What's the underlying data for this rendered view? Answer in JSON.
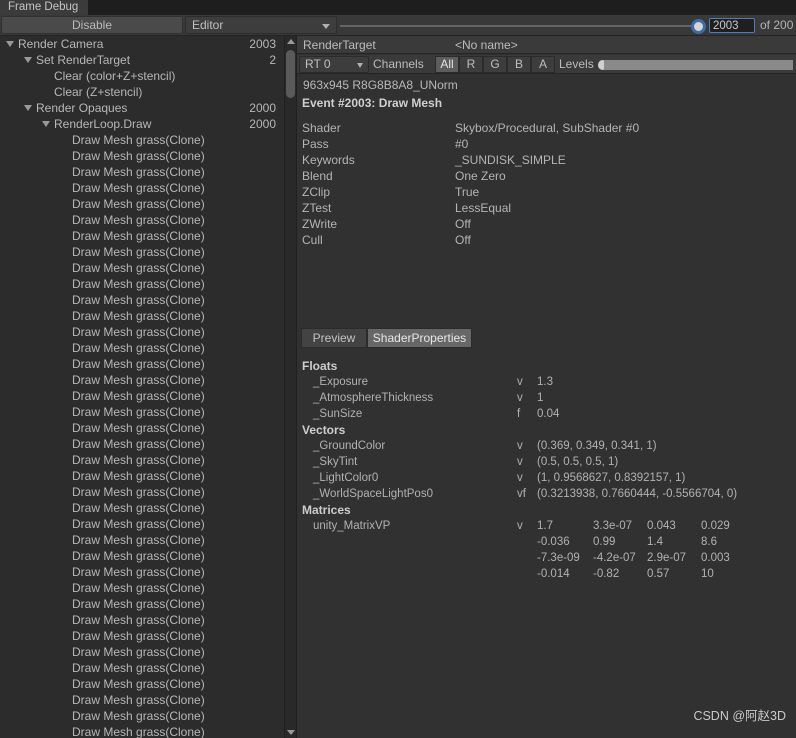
{
  "window": {
    "tab_label": "Frame Debug"
  },
  "toolbar": {
    "disable_label": "Disable",
    "target_dropdown": "Editor",
    "event_index_value": "2003",
    "event_total_label": "of 200"
  },
  "tree": {
    "rows": [
      {
        "label": "Render Camera",
        "indent": 0,
        "arrow": true,
        "count": "2003"
      },
      {
        "label": "Set RenderTarget",
        "indent": 1,
        "arrow": true,
        "count": "2"
      },
      {
        "label": "Clear (color+Z+stencil)",
        "indent": 2,
        "arrow": false,
        "count": ""
      },
      {
        "label": "Clear (Z+stencil)",
        "indent": 2,
        "arrow": false,
        "count": ""
      },
      {
        "label": "Render Opaques",
        "indent": 1,
        "arrow": true,
        "count": "2000"
      },
      {
        "label": "RenderLoop.Draw",
        "indent": 2,
        "arrow": true,
        "count": "2000"
      },
      {
        "label": "Draw Mesh grass(Clone)",
        "indent": 3,
        "arrow": false,
        "count": ""
      },
      {
        "label": "Draw Mesh grass(Clone)",
        "indent": 3,
        "arrow": false,
        "count": ""
      },
      {
        "label": "Draw Mesh grass(Clone)",
        "indent": 3,
        "arrow": false,
        "count": ""
      },
      {
        "label": "Draw Mesh grass(Clone)",
        "indent": 3,
        "arrow": false,
        "count": ""
      },
      {
        "label": "Draw Mesh grass(Clone)",
        "indent": 3,
        "arrow": false,
        "count": ""
      },
      {
        "label": "Draw Mesh grass(Clone)",
        "indent": 3,
        "arrow": false,
        "count": ""
      },
      {
        "label": "Draw Mesh grass(Clone)",
        "indent": 3,
        "arrow": false,
        "count": ""
      },
      {
        "label": "Draw Mesh grass(Clone)",
        "indent": 3,
        "arrow": false,
        "count": ""
      },
      {
        "label": "Draw Mesh grass(Clone)",
        "indent": 3,
        "arrow": false,
        "count": ""
      },
      {
        "label": "Draw Mesh grass(Clone)",
        "indent": 3,
        "arrow": false,
        "count": ""
      },
      {
        "label": "Draw Mesh grass(Clone)",
        "indent": 3,
        "arrow": false,
        "count": ""
      },
      {
        "label": "Draw Mesh grass(Clone)",
        "indent": 3,
        "arrow": false,
        "count": ""
      },
      {
        "label": "Draw Mesh grass(Clone)",
        "indent": 3,
        "arrow": false,
        "count": ""
      },
      {
        "label": "Draw Mesh grass(Clone)",
        "indent": 3,
        "arrow": false,
        "count": ""
      },
      {
        "label": "Draw Mesh grass(Clone)",
        "indent": 3,
        "arrow": false,
        "count": ""
      },
      {
        "label": "Draw Mesh grass(Clone)",
        "indent": 3,
        "arrow": false,
        "count": ""
      },
      {
        "label": "Draw Mesh grass(Clone)",
        "indent": 3,
        "arrow": false,
        "count": ""
      },
      {
        "label": "Draw Mesh grass(Clone)",
        "indent": 3,
        "arrow": false,
        "count": ""
      },
      {
        "label": "Draw Mesh grass(Clone)",
        "indent": 3,
        "arrow": false,
        "count": ""
      },
      {
        "label": "Draw Mesh grass(Clone)",
        "indent": 3,
        "arrow": false,
        "count": ""
      },
      {
        "label": "Draw Mesh grass(Clone)",
        "indent": 3,
        "arrow": false,
        "count": ""
      },
      {
        "label": "Draw Mesh grass(Clone)",
        "indent": 3,
        "arrow": false,
        "count": ""
      },
      {
        "label": "Draw Mesh grass(Clone)",
        "indent": 3,
        "arrow": false,
        "count": ""
      },
      {
        "label": "Draw Mesh grass(Clone)",
        "indent": 3,
        "arrow": false,
        "count": ""
      },
      {
        "label": "Draw Mesh grass(Clone)",
        "indent": 3,
        "arrow": false,
        "count": ""
      },
      {
        "label": "Draw Mesh grass(Clone)",
        "indent": 3,
        "arrow": false,
        "count": ""
      },
      {
        "label": "Draw Mesh grass(Clone)",
        "indent": 3,
        "arrow": false,
        "count": ""
      },
      {
        "label": "Draw Mesh grass(Clone)",
        "indent": 3,
        "arrow": false,
        "count": ""
      },
      {
        "label": "Draw Mesh grass(Clone)",
        "indent": 3,
        "arrow": false,
        "count": ""
      },
      {
        "label": "Draw Mesh grass(Clone)",
        "indent": 3,
        "arrow": false,
        "count": ""
      },
      {
        "label": "Draw Mesh grass(Clone)",
        "indent": 3,
        "arrow": false,
        "count": ""
      },
      {
        "label": "Draw Mesh grass(Clone)",
        "indent": 3,
        "arrow": false,
        "count": ""
      },
      {
        "label": "Draw Mesh grass(Clone)",
        "indent": 3,
        "arrow": false,
        "count": ""
      },
      {
        "label": "Draw Mesh grass(Clone)",
        "indent": 3,
        "arrow": false,
        "count": ""
      },
      {
        "label": "Draw Mesh grass(Clone)",
        "indent": 3,
        "arrow": false,
        "count": ""
      },
      {
        "label": "Draw Mesh grass(Clone)",
        "indent": 3,
        "arrow": false,
        "count": ""
      },
      {
        "label": "Draw Mesh grass(Clone)",
        "indent": 3,
        "arrow": false,
        "count": ""
      },
      {
        "label": "Draw Mesh grass(Clone)",
        "indent": 3,
        "arrow": false,
        "count": ""
      }
    ]
  },
  "detail": {
    "rendertarget_label": "RenderTarget",
    "rendertarget_name": "<No name>",
    "rt_select": "RT 0",
    "channels_label": "Channels",
    "channels": [
      {
        "label": "All",
        "active": true
      },
      {
        "label": "R",
        "active": false
      },
      {
        "label": "G",
        "active": false
      },
      {
        "label": "B",
        "active": false
      },
      {
        "label": "A",
        "active": false
      }
    ],
    "levels_label": "Levels",
    "format": "963x945 R8G8B8A8_UNorm",
    "event_title": "Event #2003: Draw Mesh",
    "properties": [
      {
        "key": "Shader",
        "value": "Skybox/Procedural, SubShader #0"
      },
      {
        "key": "Pass",
        "value": "#0"
      },
      {
        "key": "Keywords",
        "value": "_SUNDISK_SIMPLE"
      },
      {
        "key": "Blend",
        "value": "One Zero"
      },
      {
        "key": "ZClip",
        "value": "True"
      },
      {
        "key": "ZTest",
        "value": "LessEqual"
      },
      {
        "key": "ZWrite",
        "value": "Off"
      },
      {
        "key": "Cull",
        "value": "Off"
      }
    ],
    "subtabs": [
      {
        "label": "Preview",
        "active": false
      },
      {
        "label": "ShaderProperties",
        "active": true
      }
    ],
    "floats_header": "Floats",
    "floats": [
      {
        "name": "_Exposure",
        "type": "v",
        "value": "1.3"
      },
      {
        "name": "_AtmosphereThickness",
        "type": "v",
        "value": "1"
      },
      {
        "name": "_SunSize",
        "type": "f",
        "value": "0.04"
      }
    ],
    "vectors_header": "Vectors",
    "vectors": [
      {
        "name": "_GroundColor",
        "type": "v",
        "value": "(0.369, 0.349, 0.341, 1)"
      },
      {
        "name": "_SkyTint",
        "type": "v",
        "value": "(0.5, 0.5, 0.5, 1)"
      },
      {
        "name": "_LightColor0",
        "type": "v",
        "value": "(1, 0.9568627, 0.8392157, 1)"
      },
      {
        "name": "_WorldSpaceLightPos0",
        "type": "vf",
        "value": "(0.3213938, 0.7660444, -0.5566704, 0)"
      }
    ],
    "matrices_header": "Matrices",
    "matrix": {
      "name": "unity_MatrixVP",
      "type": "v",
      "rows": [
        [
          "1.7",
          "3.3e-07",
          "0.043",
          "0.029"
        ],
        [
          "-0.036",
          "0.99",
          "1.4",
          "8.6"
        ],
        [
          "-7.3e-09",
          "-4.2e-07",
          "2.9e-07",
          "0.003"
        ],
        [
          "-0.014",
          "-0.82",
          "0.57",
          "10"
        ]
      ]
    }
  },
  "watermark": "CSDN @阿赵3D"
}
